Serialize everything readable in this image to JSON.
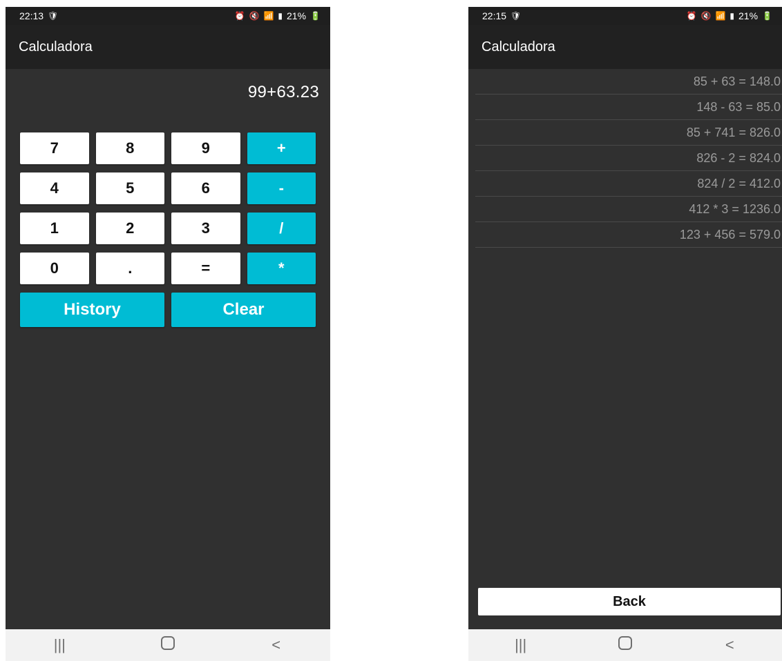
{
  "left": {
    "status": {
      "time": "22:13",
      "battery": "21%"
    },
    "app_title": "Calculadora",
    "display": "99+63.23",
    "keys": [
      [
        "7",
        "8",
        "9",
        "+"
      ],
      [
        "4",
        "5",
        "6",
        "-"
      ],
      [
        "1",
        "2",
        "3",
        "/"
      ],
      [
        "0",
        ".",
        "=",
        "*"
      ]
    ],
    "history_label": "History",
    "clear_label": "Clear",
    "nav": {
      "recents": "|||",
      "back": "<"
    }
  },
  "right": {
    "status": {
      "time": "22:15",
      "battery": "21%"
    },
    "app_title": "Calculadora",
    "history": [
      "85 + 63 = 148.0",
      "148 - 63 = 85.0",
      "85 + 741 = 826.0",
      "826 - 2 = 824.0",
      "824 / 2 = 412.0",
      "412 * 3 = 1236.0",
      "123 + 456 = 579.0"
    ],
    "back_label": "Back",
    "nav": {
      "recents": "|||",
      "back": "<"
    }
  },
  "colors": {
    "accent": "#00bcd4",
    "background": "#303030",
    "app_bar": "#212121",
    "status_bar": "#1f1f1f",
    "nav_bar": "#f2f2f2"
  },
  "icons": {
    "status_left": "shield-icon",
    "status_right": [
      "alarm-icon",
      "mute-icon",
      "wifi-icon",
      "signal-icon",
      "battery-icon"
    ]
  }
}
